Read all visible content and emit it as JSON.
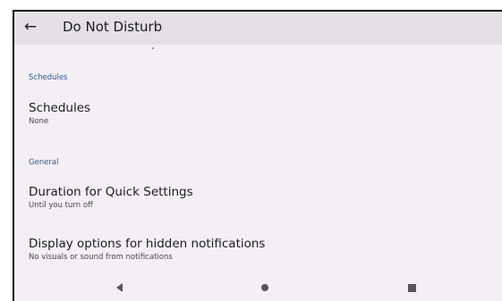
{
  "appbar": {
    "back_icon": "arrow-left-icon",
    "title": "Do Not Disturb"
  },
  "sections": {
    "schedules_header": "Schedules",
    "general_header": "General"
  },
  "items": {
    "schedules": {
      "title": "Schedules",
      "subtitle": "None"
    },
    "duration": {
      "title": "Duration for Quick Settings",
      "subtitle": "Until you turn off"
    },
    "display_options": {
      "title": "Display options for hidden notifications",
      "subtitle": "No visuals or sound from notifications"
    }
  },
  "navbar": {
    "back_icon": "triangle-back-icon",
    "home_icon": "circle-home-icon",
    "recents_icon": "square-recents-icon"
  },
  "colors": {
    "accent": "#2d5b95",
    "background": "#f3eff4",
    "appbar": "#e4e0e6"
  }
}
